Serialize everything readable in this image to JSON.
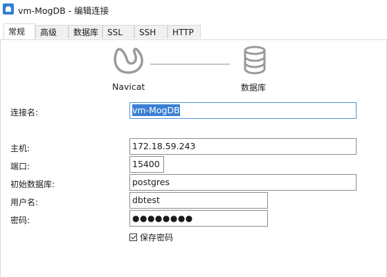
{
  "window": {
    "title": "vm-MogDB - 编辑连接"
  },
  "tabs": [
    {
      "label": "常规",
      "active": true
    },
    {
      "label": "高级"
    },
    {
      "label": "数据库"
    },
    {
      "label": "SSL"
    },
    {
      "label": "SSH"
    },
    {
      "label": "HTTP"
    }
  ],
  "diagram": {
    "left_label": "Navicat",
    "right_label": "数据库",
    "left_icon": "navicat-icon",
    "right_icon": "database-icon"
  },
  "form": {
    "connection_name": {
      "label": "连接名:",
      "value": "vm-MogDB"
    },
    "host": {
      "label": "主机:",
      "value": "172.18.59.243"
    },
    "port": {
      "label": "端口:",
      "value": "15400"
    },
    "initial_db": {
      "label": "初始数据库:",
      "value": "postgres"
    },
    "username": {
      "label": "用户名:",
      "value": "dbtest"
    },
    "password": {
      "label": "密码:",
      "value": "●●●●●●●●"
    },
    "save_password": {
      "label": "保存密码",
      "checked": true
    }
  },
  "colors": {
    "selection": "#3b7fd4",
    "focus_border": "#4a90d9",
    "icon_gray": "#9a9a9a"
  }
}
